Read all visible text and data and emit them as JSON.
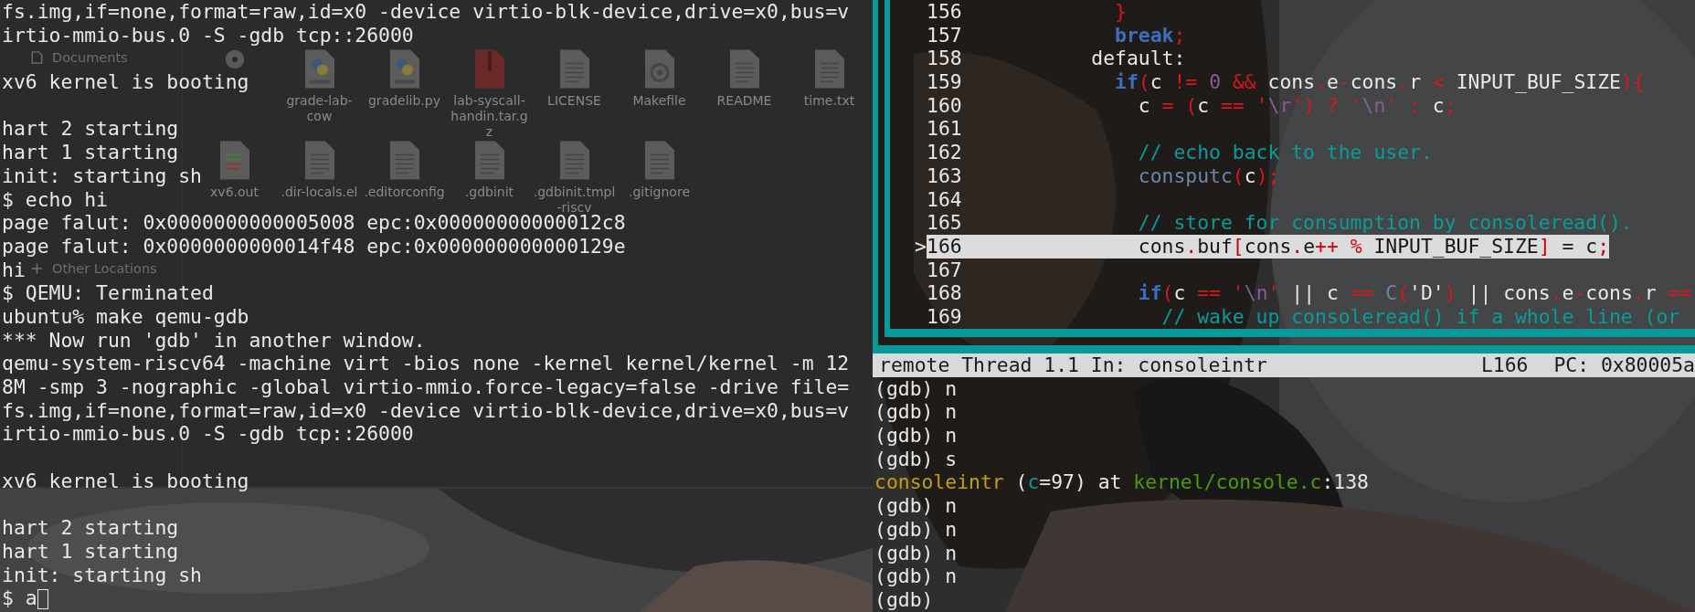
{
  "file_manager": {
    "sidebar": [
      {
        "kind": "documents",
        "label": "Documents"
      },
      {
        "kind": "other",
        "label": "Other Locations"
      }
    ],
    "files": [
      {
        "kind": "disc"
      },
      {
        "kind": "python",
        "name": "grade-lab-cow"
      },
      {
        "kind": "python",
        "name": "gradelib.py"
      },
      {
        "kind": "archive",
        "name": "lab-syscall-handin.tar.gz"
      },
      {
        "kind": "text",
        "name": "LICENSE"
      },
      {
        "kind": "gear",
        "name": "Makefile"
      },
      {
        "kind": "text",
        "name": "README"
      },
      {
        "kind": "text",
        "name": "time.txt"
      },
      {
        "kind": "patch",
        "name": "xv6.out"
      },
      {
        "kind": "text",
        "name": ".dir-locals.el"
      },
      {
        "kind": "text",
        "name": ".editorconfig"
      },
      {
        "kind": "text",
        "name": ".gdbinit"
      },
      {
        "kind": "text",
        "name": ".gdbinit.tmpl-riscv"
      },
      {
        "kind": "text",
        "name": ".gitignore"
      }
    ]
  },
  "left_terminal": {
    "lines": [
      {
        "kind": "text",
        "text": "fs.img,if=none,format=raw,id=x0 -device virtio-blk-device,drive=x0,bus=v"
      },
      {
        "kind": "text",
        "text": "irtio-mmio-bus.0 -S -gdb tcp::26000"
      },
      {
        "kind": "blank"
      },
      {
        "kind": "text",
        "text": "xv6 kernel is booting"
      },
      {
        "kind": "blank"
      },
      {
        "kind": "text",
        "text": "hart 2 starting"
      },
      {
        "kind": "text",
        "text": "hart 1 starting"
      },
      {
        "kind": "text",
        "text": "init: starting sh"
      },
      {
        "kind": "text",
        "text": "$ echo hi"
      },
      {
        "kind": "text",
        "text": "page falut: 0x0000000000005008 epc:0x00000000000012c8"
      },
      {
        "kind": "text",
        "text": "page falut: 0x0000000000014f48 epc:0x000000000000129e"
      },
      {
        "kind": "text",
        "text": "hi"
      },
      {
        "kind": "text",
        "text": "$ QEMU: Terminated"
      },
      {
        "kind": "text",
        "text": "ubuntu% make qemu-gdb"
      },
      {
        "kind": "text",
        "text": "*** Now run 'gdb' in another window."
      },
      {
        "kind": "text",
        "text": "qemu-system-riscv64 -machine virt -bios none -kernel kernel/kernel -m 12"
      },
      {
        "kind": "text",
        "text": "8M -smp 3 -nographic -global virtio-mmio.force-legacy=false -drive file="
      },
      {
        "kind": "text",
        "text": "fs.img,if=none,format=raw,id=x0 -device virtio-blk-device,drive=x0,bus=v"
      },
      {
        "kind": "text",
        "text": "irtio-mmio-bus.0 -S -gdb tcp::26000"
      },
      {
        "kind": "blank"
      },
      {
        "kind": "text",
        "text": "xv6 kernel is booting"
      },
      {
        "kind": "blank"
      },
      {
        "kind": "text",
        "text": "hart 2 starting"
      },
      {
        "kind": "text",
        "text": "hart 1 starting"
      },
      {
        "kind": "text",
        "text": "init: starting sh"
      },
      {
        "kind": "text",
        "text": "$ a"
      }
    ]
  },
  "gdb": {
    "source": {
      "marker": ">",
      "lines": [
        {
          "number": "156",
          "current": false,
          "tokens": [
            {
              "kind": "op",
              "text": "             }"
            }
          ]
        },
        {
          "number": "157",
          "current": false,
          "tokens": [
            {
              "kind": "kw",
              "text": "             break"
            },
            {
              "kind": "op",
              "text": ";"
            }
          ]
        },
        {
          "number": "158",
          "current": false,
          "tokens": [
            {
              "kind": "plain",
              "text": "           default:"
            }
          ]
        },
        {
          "number": "159",
          "current": false,
          "tokens": [
            {
              "kind": "kw",
              "text": "             if"
            },
            {
              "kind": "op",
              "text": "("
            },
            {
              "kind": "plain",
              "text": "c "
            },
            {
              "kind": "op",
              "text": "!= "
            },
            {
              "kind": "num",
              "text": "0"
            },
            {
              "kind": "op",
              "text": " &&"
            },
            {
              "kind": "plain",
              "text": " cons"
            },
            {
              "kind": "op",
              "text": "."
            },
            {
              "kind": "plain",
              "text": "e"
            },
            {
              "kind": "op",
              "text": "-"
            },
            {
              "kind": "plain",
              "text": "cons"
            },
            {
              "kind": "op",
              "text": "."
            },
            {
              "kind": "plain",
              "text": "r "
            },
            {
              "kind": "op",
              "text": "<"
            },
            {
              "kind": "plain",
              "text": " INPUT_BUF_SIZE"
            },
            {
              "kind": "op",
              "text": "){"
            }
          ]
        },
        {
          "number": "160",
          "current": false,
          "tokens": [
            {
              "kind": "plain",
              "text": "               c "
            },
            {
              "kind": "op",
              "text": "= ("
            },
            {
              "kind": "plain",
              "text": "c "
            },
            {
              "kind": "op",
              "text": "== '"
            },
            {
              "kind": "esc",
              "text": "\\r"
            },
            {
              "kind": "op",
              "text": "') ? '"
            },
            {
              "kind": "esc",
              "text": "\\n"
            },
            {
              "kind": "op",
              "text": "' : "
            },
            {
              "kind": "plain",
              "text": "c"
            },
            {
              "kind": "op",
              "text": ";"
            }
          ]
        },
        {
          "number": "161",
          "current": false
        },
        {
          "number": "162",
          "current": false,
          "tokens": [
            {
              "kind": "cm",
              "text": "               // echo back to the user."
            }
          ]
        },
        {
          "number": "163",
          "current": false,
          "tokens": [
            {
              "kind": "fn",
              "text": "               consputc"
            },
            {
              "kind": "op",
              "text": "("
            },
            {
              "kind": "plain",
              "text": "c"
            },
            {
              "kind": "op",
              "text": ");"
            }
          ]
        },
        {
          "number": "164",
          "current": false
        },
        {
          "number": "165",
          "current": false,
          "tokens": [
            {
              "kind": "cm",
              "text": "               // store for consumption by consoleread()."
            }
          ]
        },
        {
          "number": "166",
          "current": true,
          "tokens": [
            {
              "kind": "plain",
              "text": "               cons"
            },
            {
              "kind": "op",
              "text": "."
            },
            {
              "kind": "plain",
              "text": "buf"
            },
            {
              "kind": "op",
              "text": "["
            },
            {
              "kind": "plain",
              "text": "cons"
            },
            {
              "kind": "op",
              "text": "."
            },
            {
              "kind": "plain",
              "text": "e"
            },
            {
              "kind": "op",
              "text": "++ %"
            },
            {
              "kind": "plain",
              "text": " INPUT_BUF_SIZE"
            },
            {
              "kind": "op",
              "text": "]"
            },
            {
              "kind": "plain",
              "text": " = c"
            },
            {
              "kind": "op",
              "text": ";"
            }
          ]
        },
        {
          "number": "167",
          "current": false
        },
        {
          "number": "168",
          "current": false,
          "tokens": [
            {
              "kind": "kw",
              "text": "               if"
            },
            {
              "kind": "op",
              "text": "("
            },
            {
              "kind": "plain",
              "text": "c "
            },
            {
              "kind": "op",
              "text": "== '"
            },
            {
              "kind": "esc",
              "text": "\\n"
            },
            {
              "kind": "op",
              "text": "'"
            },
            {
              "kind": "plain",
              "text": " || c "
            },
            {
              "kind": "op",
              "text": "== "
            },
            {
              "kind": "fn",
              "text": "C"
            },
            {
              "kind": "op",
              "text": "("
            },
            {
              "kind": "plain",
              "text": "'D'"
            },
            {
              "kind": "op",
              "text": ")"
            },
            {
              "kind": "plain",
              "text": " || cons"
            },
            {
              "kind": "op",
              "text": "."
            },
            {
              "kind": "plain",
              "text": "e"
            },
            {
              "kind": "op",
              "text": "-"
            },
            {
              "kind": "plain",
              "text": "cons"
            },
            {
              "kind": "op",
              "text": "."
            },
            {
              "kind": "plain",
              "text": "r "
            },
            {
              "kind": "op",
              "text": "=="
            }
          ]
        },
        {
          "number": "169",
          "current": false,
          "tokens": [
            {
              "kind": "cm",
              "text": "                 // wake up consoleread() if a whole line (or"
            }
          ]
        }
      ]
    },
    "status_bar": {
      "target": "remote Thread 1.1 In: consoleintr",
      "line": "L166",
      "pc": "PC: 0x80005a"
    },
    "console": [
      {
        "kind": "prompt",
        "text": "(gdb) n"
      },
      {
        "kind": "prompt",
        "text": "(gdb) n"
      },
      {
        "kind": "prompt",
        "text": "(gdb) n"
      },
      {
        "kind": "prompt",
        "text": "(gdb) s"
      },
      {
        "kind": "frame",
        "tokens": [
          {
            "kind": "function",
            "text": "consoleintr"
          },
          {
            "kind": "plain",
            "text": " ("
          },
          {
            "kind": "arg",
            "text": "c"
          },
          {
            "kind": "plain",
            "text": "=97) at "
          },
          {
            "kind": "path",
            "text": "kernel/console.c"
          },
          {
            "kind": "plain",
            "text": ":138"
          }
        ]
      },
      {
        "kind": "prompt",
        "text": "(gdb) n"
      },
      {
        "kind": "prompt",
        "text": "(gdb) n"
      },
      {
        "kind": "prompt",
        "text": "(gdb) n"
      },
      {
        "kind": "prompt",
        "text": "(gdb) n"
      },
      {
        "kind": "prompt",
        "text": "(gdb)"
      }
    ]
  }
}
